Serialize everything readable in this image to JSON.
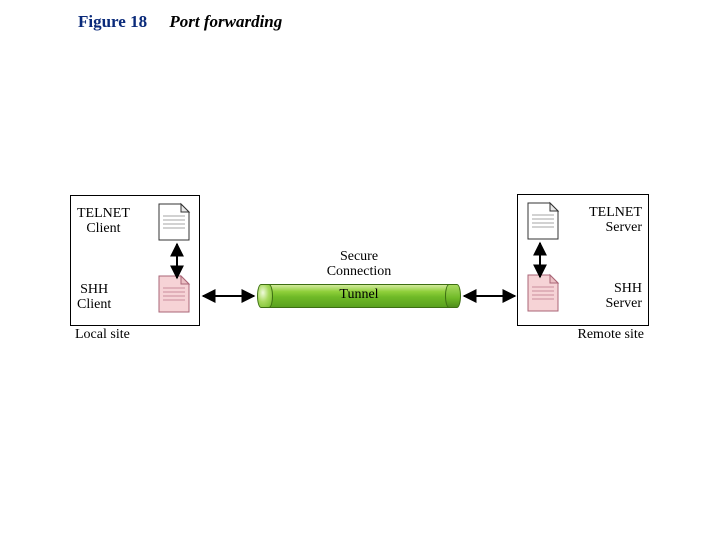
{
  "figure": {
    "number": "Figure 18",
    "caption": "Port forwarding"
  },
  "local": {
    "siteLabel": "Local site",
    "telnet": {
      "l1": "TELNET",
      "l2": "Client"
    },
    "ssh": {
      "l1": "SHH",
      "l2": "Client"
    }
  },
  "remote": {
    "siteLabel": "Remote site",
    "telnet": {
      "l1": "TELNET",
      "l2": "Server"
    },
    "ssh": {
      "l1": "SHH",
      "l2": "Server"
    }
  },
  "connection": {
    "secureLine1": "Secure",
    "secureLine2": "Connection",
    "tunnel": "Tunnel"
  },
  "colors": {
    "titleBlue": "#0a2a7a",
    "tunnelGreen": "#6fb927",
    "docPink": "#f6d3d6"
  },
  "chart_data": null
}
